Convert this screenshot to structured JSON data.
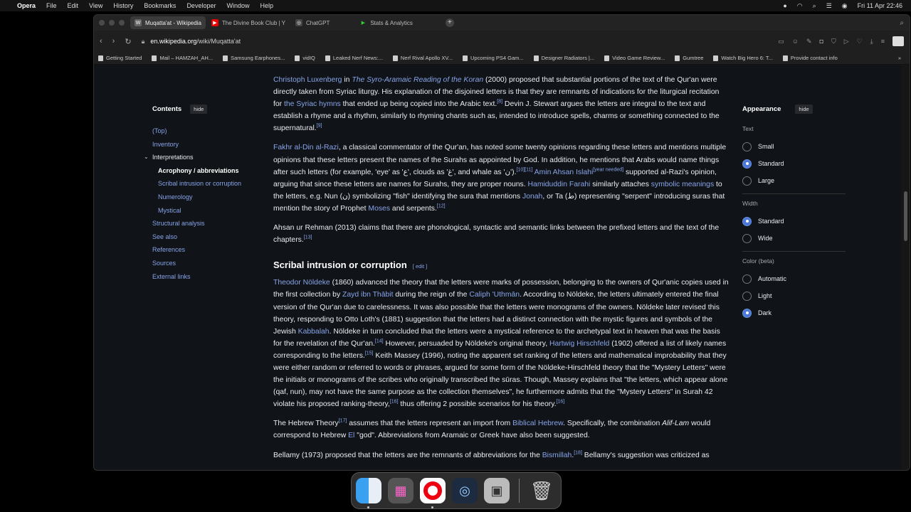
{
  "menubar": {
    "app": "Opera",
    "items": [
      "File",
      "Edit",
      "View",
      "History",
      "Bookmarks",
      "Developer",
      "Window",
      "Help"
    ],
    "clock": "Fri 11 Apr  22:46"
  },
  "tabs": [
    {
      "label": "Muqatta'at - Wikipedia",
      "favicon": "W",
      "color": "#555"
    },
    {
      "label": "The Divine Book Club | Y",
      "favicon": "▶",
      "color": "#e00"
    },
    {
      "label": "ChatGPT",
      "favicon": "◎",
      "color": "#444"
    },
    {
      "label": "Stats & Analytics",
      "favicon": "▶",
      "color": "#1a1a1a"
    }
  ],
  "address": {
    "domain": "en.wikipedia.org",
    "path": "/wiki/Muqatta'at"
  },
  "bookmarks": [
    "Getting Started",
    "Mail – HAMZAH_AH...",
    "Samsung Earphones...",
    "vidIQ",
    "Leaked Nerf News:...",
    "Nerf Rival Apollo XV...",
    "Upcoming PS4 Gam...",
    "Designer Radiators |...",
    "Video Game Review...",
    "Gumtree",
    "Watch Big Hero 6: T...",
    "Provide contact info"
  ],
  "toc": {
    "title": "Contents",
    "hide": "hide",
    "items": [
      {
        "label": "(Top)",
        "level": 0
      },
      {
        "label": "Inventory",
        "level": 0
      },
      {
        "label": "Interpretations",
        "level": 0,
        "parent": true
      },
      {
        "label": "Acrophony / abbreviations",
        "level": 1,
        "current": true
      },
      {
        "label": "Scribal intrusion or corruption",
        "level": 1
      },
      {
        "label": "Numerology",
        "level": 1
      },
      {
        "label": "Mystical",
        "level": 1
      },
      {
        "label": "Structural analysis",
        "level": 0
      },
      {
        "label": "See also",
        "level": 0
      },
      {
        "label": "References",
        "level": 0
      },
      {
        "label": "Sources",
        "level": 0
      },
      {
        "label": "External links",
        "level": 0
      }
    ]
  },
  "appearance": {
    "title": "Appearance",
    "hide": "hide",
    "groups": [
      {
        "label": "Text",
        "options": [
          "Small",
          "Standard",
          "Large"
        ],
        "selected": "Standard"
      },
      {
        "label": "Width",
        "options": [
          "Standard",
          "Wide"
        ],
        "selected": "Standard"
      },
      {
        "label": "Color (beta)",
        "options": [
          "Automatic",
          "Light",
          "Dark"
        ],
        "selected": "Dark"
      }
    ]
  },
  "article": {
    "section_heading": "Scribal intrusion or corruption",
    "edit": "edit",
    "p1": [
      [
        "a",
        "Christoph Luxenberg"
      ],
      [
        "t",
        " in "
      ],
      [
        "ai",
        "The Syro-Aramaic Reading of the Koran"
      ],
      [
        "t",
        " (2000) proposed that substantial portions of the text of the Qur'an were directly taken from Syriac liturgy. His explanation of the disjoined letters is that they are remnants of indications for the liturgical recitation for "
      ],
      [
        "a",
        "the Syriac hymns"
      ],
      [
        "t",
        " that ended up being copied into the Arabic text."
      ],
      [
        "s",
        "[8]"
      ],
      [
        "t",
        " Devin J. Stewart argues the letters are integral to the text and establish a rhyme and a rhythm, similarly to rhyming chants such as, intended to introduce spells, charms or something connected to the supernatural."
      ],
      [
        "s",
        "[9]"
      ]
    ],
    "p2": [
      [
        "a",
        "Fakhr al-Din al-Razi"
      ],
      [
        "t",
        ", a classical commentator of the Qur'an, has noted some twenty opinions regarding these letters and mentions multiple opinions that these letters present the names of the Surahs as appointed by God. In addition, he mentions that Arabs would name things after such letters (for example, 'eye' as 'ع', clouds as 'غ', and whale as 'ن')."
      ],
      [
        "s",
        "[10][11]"
      ],
      [
        "t",
        " "
      ],
      [
        "a",
        "Amin Ahsan Islahi"
      ],
      [
        "s",
        "[year needed]"
      ],
      [
        "t",
        " supported al-Razi's opinion, arguing that since these letters are names for Surahs, they are proper nouns. "
      ],
      [
        "a",
        "Hamiduddin Farahi"
      ],
      [
        "t",
        " similarly attaches "
      ],
      [
        "a",
        "symbolic meanings"
      ],
      [
        "t",
        " to the letters, e.g. Nun (ن) symbolizing \"fish\" identifying the sura that mentions "
      ],
      [
        "a",
        "Jonah"
      ],
      [
        "t",
        ", or Ta (ط) representing \"serpent\" introducing suras that mention the story of Prophet "
      ],
      [
        "a",
        "Moses"
      ],
      [
        "t",
        " and serpents."
      ],
      [
        "s",
        "[12]"
      ]
    ],
    "p3": [
      [
        "t",
        "Ahsan ur Rehman (2013) claims that there are phonological, syntactic and semantic links between the prefixed letters and the text of the chapters."
      ],
      [
        "s",
        "[13]"
      ]
    ],
    "p4": [
      [
        "a",
        "Theodor Nöldeke"
      ],
      [
        "t",
        " (1860) advanced the theory that the letters were marks of possession, belonging to the owners of Qur'anic copies used in the first collection by "
      ],
      [
        "a",
        "Zayd ibn Thābit"
      ],
      [
        "t",
        " during the reign of the "
      ],
      [
        "a",
        "Caliph 'Uthmān"
      ],
      [
        "t",
        ". According to Nöldeke, the letters ultimately entered the final version of the Qur'an due to carelessness. It was also possible that the letters were monograms of the owners. Nöldeke later revised this theory, responding to Otto Loth's (1881) suggestion that the letters had a distinct connection with the mystic figures and symbols of the Jewish "
      ],
      [
        "a",
        "Kabbalah"
      ],
      [
        "t",
        ". Nöldeke in turn concluded that the letters were a mystical reference to the archetypal text in heaven that was the basis for the revelation of the Qur'an."
      ],
      [
        "s",
        "[14]"
      ],
      [
        "t",
        " However, persuaded by Nöldeke's original theory, "
      ],
      [
        "a",
        "Hartwig Hirschfeld"
      ],
      [
        "t",
        " (1902) offered a list of likely names corresponding to the letters."
      ],
      [
        "s",
        "[15]"
      ],
      [
        "t",
        " Keith Massey (1996), noting the apparent set ranking of the letters and mathematical improbability that they were either random or referred to words or phrases, argued for some form of the Nöldeke-Hirschfeld theory that the \"Mystery Letters\" were the initials or monograms of the scribes who originally transcribed the sūras. Though, Massey explains that \"the letters, which appear alone (qaf, nun), may not have the same purpose as the collection themselves\", he furthermore admits that the \"Mystery Letters\" in Surah 42 violate his proposed ranking-theory,"
      ],
      [
        "s",
        "[16]"
      ],
      [
        "t",
        " thus offering 2 possible scenarios for his theory."
      ],
      [
        "s",
        "[16]"
      ]
    ],
    "p5": [
      [
        "t",
        "The Hebrew Theory"
      ],
      [
        "s",
        "[17]"
      ],
      [
        "t",
        " assumes that the letters represent an import from "
      ],
      [
        "a",
        "Biblical Hebrew"
      ],
      [
        "t",
        ". Specifically, the combination "
      ],
      [
        "i",
        "Alif-Lam"
      ],
      [
        "t",
        " would correspond to Hebrew "
      ],
      [
        "a",
        "El"
      ],
      [
        "t",
        " \"god\". Abbreviations from Aramaic or Greek have also been suggested."
      ]
    ],
    "p6": [
      [
        "t",
        "Bellamy (1973) proposed that the letters are the remnants of abbreviations for the "
      ],
      [
        "a",
        "Bismillah"
      ],
      [
        "t",
        "."
      ],
      [
        "s",
        "[18]"
      ],
      [
        "t",
        " Bellamy's suggestion was criticized as"
      ]
    ]
  },
  "dock": [
    "finder-icon",
    "launchpad-icon",
    "opera-icon",
    "quicktime-icon",
    "preview-icon",
    "trash-icon"
  ]
}
